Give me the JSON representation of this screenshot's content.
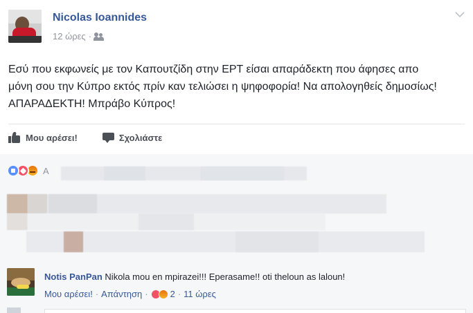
{
  "post": {
    "author": "Nicolas Ioannides",
    "time": "12 ώρες",
    "separator": "·",
    "audience_icon": "friends-icon",
    "text": "Εσύ που εκφωνείς με τον Καπουτζίδη στην ΕΡΤ είσαι απαράδεκτη που άφησες απο μόνη σου την Κύπρο εκτός πρίν καν τελιώσει η ψηφοφορία! Να απολογηθείς δημοσίως! ΑΠΑΡΑΔΕΚΤΗ! Μπράβο Κύπρος!"
  },
  "actions": {
    "like_label": "Μου αρέσει!",
    "comment_label": "Σχολιάστε"
  },
  "reactions": {
    "icons": [
      "like-reaction-icon",
      "love-reaction-icon",
      "angry-reaction-icon"
    ],
    "summary_visible": "A"
  },
  "comment": {
    "author": "Notis PanPan",
    "text": "Nikola mou en mpirazei!!! Eperasame!! oti theloun as laloun!",
    "like_label": "Μου αρέσει!",
    "sep1": "·",
    "reply_label": "Απάντηση",
    "sep2": "·",
    "reaction_count": "2",
    "sep3": "·",
    "time": "11 ώρες"
  },
  "colors": {
    "link": "#365899",
    "text": "#1d2129",
    "muted": "#90949c",
    "comments_bg": "#f6f7f9"
  }
}
